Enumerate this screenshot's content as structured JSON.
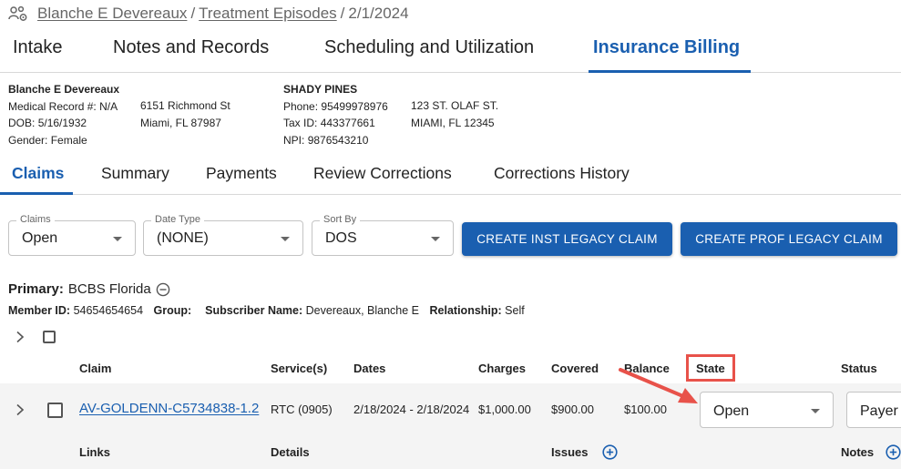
{
  "breadcrumb": {
    "patient": "Blanche E Devereaux",
    "section": "Treatment Episodes",
    "date": "2/1/2024",
    "separator": "/"
  },
  "top_tabs": [
    "Intake",
    "Notes and Records",
    "Scheduling and Utilization",
    "Insurance Billing"
  ],
  "top_tabs_active": "Insurance Billing",
  "patient": {
    "name": "Blanche E Devereaux",
    "medical_record_label": "Medical Record #:",
    "medical_record": "N/A",
    "dob_label": "DOB:",
    "dob": "5/16/1932",
    "gender_label": "Gender:",
    "gender": "Female",
    "address_line1": "6151 Richmond St",
    "address_line2": "Miami, FL 87987"
  },
  "facility": {
    "name": "SHADY PINES",
    "phone_label": "Phone:",
    "phone": "95499978976",
    "tax_label": "Tax ID:",
    "tax_id": "443377661",
    "npi_label": "NPI:",
    "npi": "9876543210",
    "address_line1": "123 ST. OLAF ST.",
    "address_line2": "MIAMI, FL 12345"
  },
  "sub_tabs": [
    "Claims",
    "Summary",
    "Payments",
    "Review Corrections",
    "Corrections History"
  ],
  "sub_tabs_active": "Claims",
  "filters": {
    "claims": {
      "label": "Claims",
      "value": "Open"
    },
    "date_type": {
      "label": "Date Type",
      "value": "(NONE)"
    },
    "sort_by": {
      "label": "Sort By",
      "value": "DOS"
    }
  },
  "buttons": {
    "create_inst": "CREATE INST LEGACY CLAIM",
    "create_prof": "CREATE PROF LEGACY CLAIM"
  },
  "insurance": {
    "primary_label": "Primary:",
    "primary_value": "BCBS Florida",
    "member_id_label": "Member ID:",
    "member_id": "54654654654",
    "group_label": "Group:",
    "group": "",
    "subscriber_label": "Subscriber Name:",
    "subscriber": "Devereaux, Blanche E",
    "relationship_label": "Relationship:",
    "relationship": "Self"
  },
  "table": {
    "headers": {
      "claim": "Claim",
      "services": "Service(s)",
      "dates": "Dates",
      "charges": "Charges",
      "covered": "Covered",
      "balance": "Balance",
      "state": "State",
      "status": "Status"
    },
    "row": {
      "claim": "AV-GOLDENN-C5734838-1.2",
      "services": "RTC (0905)",
      "dates": "2/18/2024 - 2/18/2024",
      "charges": "$1,000.00",
      "covered": "$900.00",
      "balance": "$100.00",
      "state": "Open",
      "status": "Payer"
    },
    "sub_labels": {
      "links": "Links",
      "details": "Details",
      "issues": "Issues",
      "notes": "Notes"
    }
  },
  "colors": {
    "accent": "#1a5fb0",
    "highlight": "#e8524a",
    "row_background": "#f4f4f4"
  },
  "icons": [
    "people-gear-icon",
    "minus-circle-icon",
    "chevron-right-icon",
    "plus-circle-icon",
    "caret-down-icon"
  ]
}
